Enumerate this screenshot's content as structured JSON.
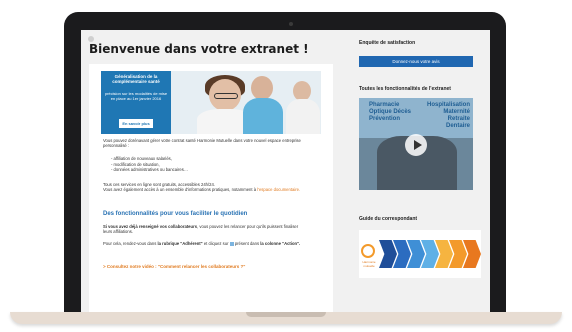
{
  "page": {
    "title": "Bienvenue dans votre extranet !"
  },
  "hero": {
    "box_title": "Généralisation de la complémentaire santé",
    "box_sub": "précision sur les modalités de mise en place au 1er janvier 2016",
    "button_label": "En savoir plus"
  },
  "content": {
    "intro": "Vous pouvez dorénavant gérer votre contrat santé Harmonie Mutuelle dans votre nouvel espace entreprise personnalisé :",
    "list": [
      "- affiliation de nouveaux salariés,",
      "- modification de situation,",
      "- données administratives ou bancaires…"
    ],
    "services_1": "Tous ces services en ligne sont gratuits, accessibles 24h/24.",
    "services_2": "Vous avez également accès à un ensemble d'informations pratiques, notamment à",
    "services_link": "l'espace documentaire.",
    "section_title": "Des fonctionnalités pour vous faciliter le quotidien",
    "relance_bold": "Si vous avez déjà renseigné vos collaborateurs",
    "relance_rest": ", vous pouvez les relancer pour qu'ils puissent finaliser leurs affiliations.",
    "howto_1": "Pour cela, rendez-vous dans",
    "howto_bold1": "la rubrique \"Adhérent\"",
    "howto_2": "et cliquez sur",
    "howto_3": "présent dans",
    "howto_bold2": "la colonne \"Action\".",
    "cta": "> Consultez notre vidéo : \"Comment relancer les collaborateurs ?\""
  },
  "sidebar": {
    "survey_title": "Enquête de satisfaction",
    "survey_button": "Donnez-nous votre avis",
    "features_title": "Toutes les fonctionnalités de l'extranet",
    "video_words_left": [
      "Pharmacie",
      "Optique Décès",
      "Prévention"
    ],
    "video_words_right": [
      "Hospitalisation",
      "Maternité",
      "Retraite",
      "Dentaire"
    ],
    "guide_title": "Guide du correspondant",
    "guide_logo_text": "Harmonie mutuelle"
  },
  "colors": {
    "brand_blue": "#2067b1",
    "accent_orange": "#e07a1f",
    "guide_chevrons": [
      "#1f4e99",
      "#2b6cc0",
      "#3f8fd6",
      "#5fb0e6",
      "#f6b440",
      "#f39a2b",
      "#e8781f"
    ]
  }
}
